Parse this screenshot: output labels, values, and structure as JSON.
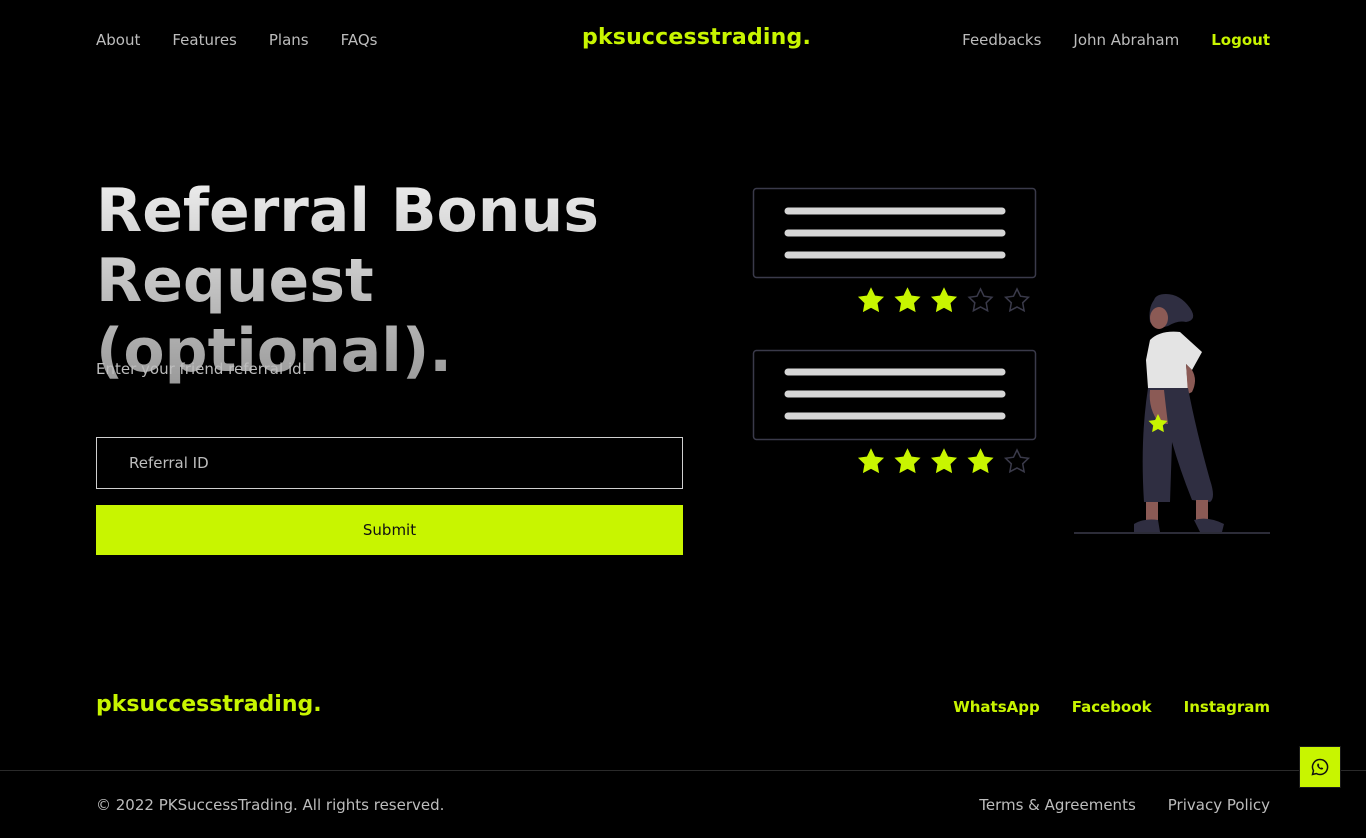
{
  "nav": {
    "left": [
      "About",
      "Features",
      "Plans",
      "FAQs"
    ],
    "brand": "pksuccesstrading.",
    "feedbacks": "Feedbacks",
    "user": "John Abraham",
    "logout": "Logout"
  },
  "hero": {
    "title_line1": "Referral Bonus",
    "title_line2": "Request (optional).",
    "subtitle": "Enter your friend referral id!"
  },
  "form": {
    "placeholder": "Referral ID",
    "submit": "Submit"
  },
  "illustration": {
    "cards": [
      {
        "rating": 3,
        "max": 5
      },
      {
        "rating": 4,
        "max": 5
      }
    ]
  },
  "footer": {
    "brand": "pksuccesstrading.",
    "social": [
      "WhatsApp",
      "Facebook",
      "Instagram"
    ],
    "copyright": "© 2022 PKSuccessTrading. All rights reserved.",
    "terms": "Terms & Agreements",
    "privacy": "Privacy Policy"
  },
  "colors": {
    "accent": "#c8f500",
    "background": "#000000",
    "text": "#bdbdbd"
  },
  "icons": {
    "floating_button": "whatsapp-icon"
  }
}
